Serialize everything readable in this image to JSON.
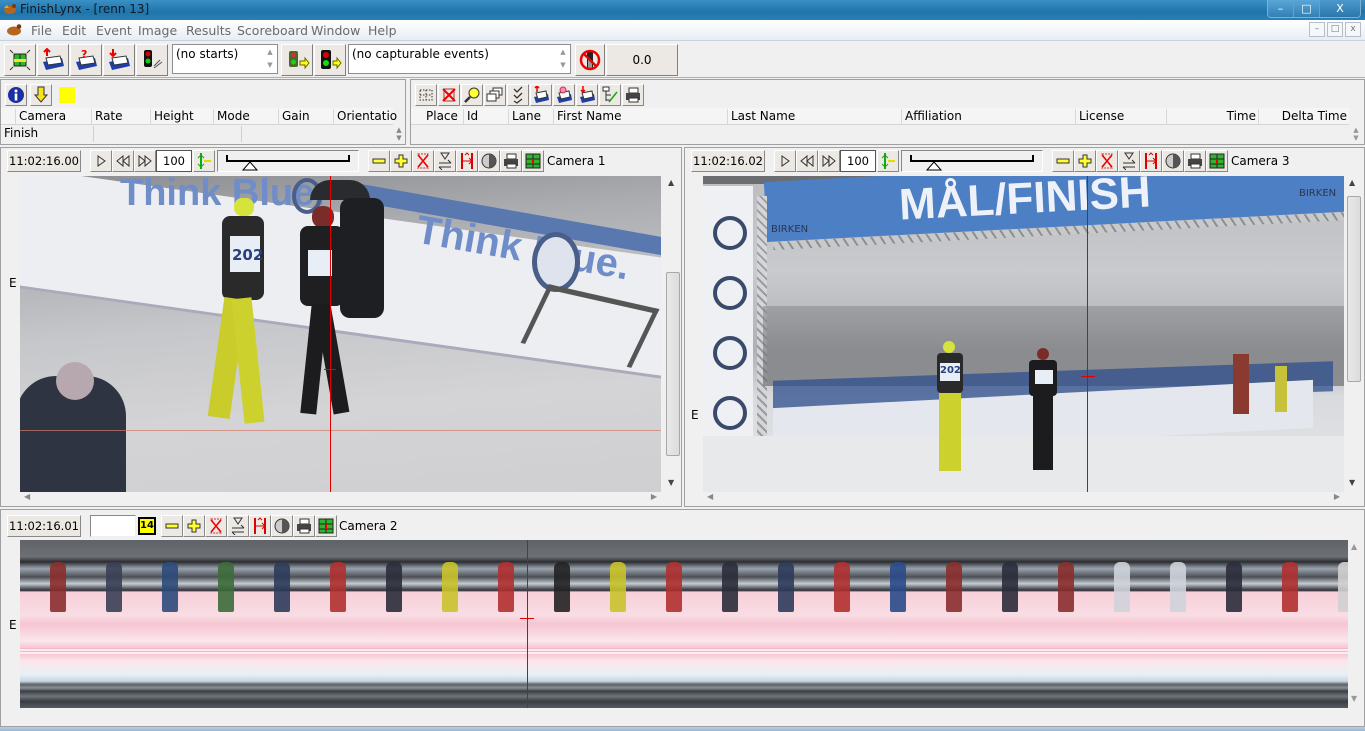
{
  "window": {
    "title": "FinishLynx - [renn 13]",
    "controls": [
      "minimize-icon",
      "restore-icon",
      "close-icon"
    ],
    "control_glyphs": [
      "–",
      "□",
      "X"
    ]
  },
  "menubar": {
    "items": [
      "File",
      "Edit",
      "Event",
      "Image",
      "Results",
      "Scoreboard",
      "Window",
      "Help"
    ],
    "mdi_glyphs": [
      "–",
      "□",
      "x"
    ]
  },
  "toolbar": {
    "icons": [
      "camera-grid-icon",
      "upload-event-icon",
      "query-event-icon",
      "download-event-icon",
      "start-light-icon"
    ],
    "starts_combo": "(no starts)",
    "capture_icons": [
      "capture-arm-icon",
      "traffic-light-icon"
    ],
    "events_combo": "(no capturable events)",
    "no-wind-icon": "no-wind-icon",
    "wind_value": "0.0"
  },
  "camera_panel": {
    "icons": [
      "info-icon",
      "arrow-down-icon",
      "yellow-color-swatch"
    ],
    "columns": [
      "Camera",
      "Rate",
      "Height",
      "Mode",
      "Gain",
      "Orientatio"
    ],
    "rows": [
      [
        "Finish",
        "",
        "",
        "",
        "",
        ""
      ]
    ],
    "swatch_color": "#ffff00"
  },
  "results_panel": {
    "icons": [
      "select-all-icon",
      "delete-icon",
      "find-icon",
      "windows-icon",
      "check-icon",
      "upload-icon",
      "query-icon",
      "download-icon",
      "tree-icon",
      "print-icon"
    ],
    "columns": [
      "Place",
      "Id",
      "Lane",
      "First Name",
      "Last Name",
      "Affiliation",
      "License",
      "Time",
      "Delta Time"
    ],
    "rows": []
  },
  "views": {
    "camera1": {
      "time": "11:02:16.00",
      "zoom": "100",
      "label": "Camera 1",
      "edge_label": "E",
      "banner_text": "Think Blue.",
      "bib": "202"
    },
    "camera3": {
      "time": "11:02:16.02",
      "zoom": "100",
      "label": "Camera 3",
      "edge_label": "E",
      "banner_text": "MÅL/FINISH",
      "sponsor_text": "BIRKEN",
      "bib": "202"
    },
    "camera2": {
      "time": "11:02:16.01",
      "input_value": "",
      "font_size_badge": "14",
      "label": "Camera 2",
      "edge_label": "E"
    }
  },
  "colors": {
    "accent_red": "#e00000",
    "titlebar_blue": "#2278ae",
    "photo_pink": "#f6c7d2"
  }
}
